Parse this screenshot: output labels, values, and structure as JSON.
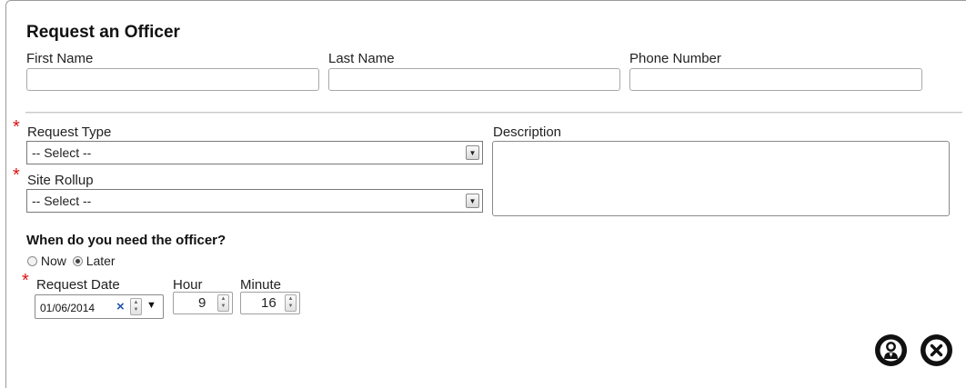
{
  "form": {
    "title": "Request an Officer",
    "first_name_label": "First Name",
    "last_name_label": "Last Name",
    "phone_label": "Phone Number",
    "first_name_value": "",
    "last_name_value": "",
    "phone_value": "",
    "required_marker": "*",
    "request_type_label": "Request Type",
    "request_type_value": "-- Select --",
    "site_rollup_label": "Site Rollup",
    "site_rollup_value": "-- Select --",
    "description_label": "Description",
    "when_question": "When do you need the officer?",
    "timing_options": [
      {
        "label": "Now",
        "selected": false
      },
      {
        "label": "Later",
        "selected": true
      }
    ],
    "request_date_label": "Request Date",
    "request_date_value": "01/06/2014",
    "hour_label": "Hour",
    "hour_value": "9",
    "minute_label": "Minute",
    "minute_value": "16"
  },
  "actions": {
    "officer_icon": "officer-icon",
    "close_icon": "close-icon"
  },
  "colors": {
    "required": "#dd1111",
    "button_fill": "#111111",
    "border": "#a9a9a9"
  }
}
